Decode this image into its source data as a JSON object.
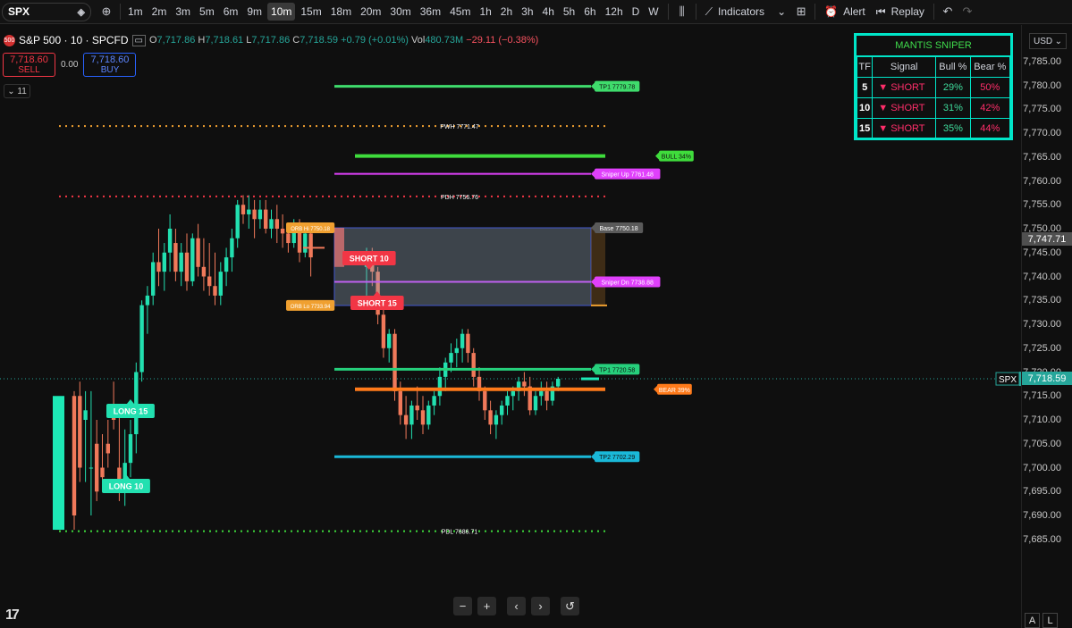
{
  "toolbar": {
    "symbol": "SPX",
    "intervals": [
      "1m",
      "2m",
      "3m",
      "5m",
      "6m",
      "9m",
      "10m",
      "15m",
      "18m",
      "20m",
      "30m",
      "36m",
      "45m",
      "1h",
      "2h",
      "3h",
      "4h",
      "5h",
      "6h",
      "12h",
      "D",
      "W"
    ],
    "active_interval": "10m",
    "indicators_label": "Indicators",
    "alert_label": "Alert",
    "replay_label": "Replay"
  },
  "legend": {
    "badge": "500",
    "name": "S&P 500 · 10 · SPCFD",
    "open_label": "O",
    "open": "7,717.86",
    "high_label": "H",
    "high": "7,718.61",
    "low_label": "L",
    "low": "7,717.86",
    "close_label": "C",
    "close": "7,718.59",
    "change": "+0.79 (+0.01%)",
    "vol_label": "Vol",
    "vol": "480.73M",
    "vol_change": "−29.11 (−0.38%)"
  },
  "trade": {
    "sell_price": "7,718.60",
    "sell_label": "SELL",
    "spread": "0.00",
    "buy_price": "7,718.60",
    "buy_label": "BUY",
    "collapse_count": "11"
  },
  "axis": {
    "currency": "USD",
    "ticks": [
      "7,785.00",
      "7,780.00",
      "7,775.00",
      "7,770.00",
      "7,765.00",
      "7,760.00",
      "7,755.00",
      "7,750.00",
      "7,745.00",
      "7,740.00",
      "7,735.00",
      "7,730.00",
      "7,725.00",
      "7,720.00",
      "7,715.00",
      "7,710.00",
      "7,705.00",
      "7,700.00",
      "7,695.00",
      "7,690.00",
      "7,685.00"
    ],
    "tag_gray": "7,747.71",
    "tag_symbol": "SPX",
    "tag_price": "7,718.59"
  },
  "levels": {
    "tp1_high": "TP1 7779.78",
    "pwh": "PWH 7771.47",
    "bull": "BULL 34%",
    "sniper_up": "Sniper Up 7761.48",
    "pdh": "PDH 7756.76",
    "orb_hi": "ORB Hi 7750.18",
    "base": "Base 7750.18",
    "short10": "SHORT 10",
    "short15": "SHORT 15",
    "sniper_dn": "Sniper Dn 7738.88",
    "orb_lo": "ORB Lo 7733.94",
    "tp1_low": "TP1 7720.58",
    "bear": "BEAR 39%",
    "long15": "LONG 15",
    "long10": "LONG 10",
    "tp2": "TP2 7702.29",
    "pdl": "PDL 7686.71"
  },
  "mantis": {
    "title": "MANTIS SNIPER",
    "headers": [
      "TF",
      "Signal",
      "Bull %",
      "Bear %"
    ],
    "rows": [
      {
        "tf": "5",
        "signal": "▼ SHORT",
        "bull": "29%",
        "bear": "50%"
      },
      {
        "tf": "10",
        "signal": "▼ SHORT",
        "bull": "31%",
        "bear": "42%"
      },
      {
        "tf": "15",
        "signal": "▼ SHORT",
        "bull": "35%",
        "bear": "44%"
      }
    ]
  },
  "colors": {
    "up": "#22e0b0",
    "down": "#f0795a",
    "bg": "#0f0f0f",
    "accent": "#00e5c8"
  },
  "chart_data": {
    "type": "candlestick",
    "symbol": "S&P 500 · 10 · SPCFD",
    "ylim": [
      7682,
      7788
    ],
    "candles": [
      [
        7715,
        7716,
        7687,
        7690
      ],
      [
        7715,
        7718,
        7697,
        7700
      ],
      [
        7710,
        7716,
        7697,
        7712
      ],
      [
        7700,
        7716,
        7690,
        7700
      ],
      [
        7705,
        7710,
        7693,
        7695
      ],
      [
        7700,
        7707,
        7697,
        7698
      ],
      [
        7705,
        7710,
        7700,
        7703
      ],
      [
        7712,
        7718,
        7708,
        7710
      ],
      [
        7700,
        7712,
        7693,
        7697
      ],
      [
        7697,
        7708,
        7692,
        7701
      ],
      [
        7701,
        7710,
        7698,
        7707
      ],
      [
        7707,
        7722,
        7703,
        7720
      ],
      [
        7720,
        7735,
        7718,
        7734
      ],
      [
        7734,
        7738,
        7728,
        7736
      ],
      [
        7736,
        7745,
        7734,
        7743
      ],
      [
        7743,
        7750,
        7738,
        7741
      ],
      [
        7741,
        7747,
        7737,
        7745
      ],
      [
        7745,
        7753,
        7741,
        7750
      ],
      [
        7747,
        7750,
        7739,
        7741
      ],
      [
        7741,
        7747,
        7738,
        7745
      ],
      [
        7745,
        7749,
        7737,
        7739
      ],
      [
        7739,
        7749,
        7738,
        7748
      ],
      [
        7748,
        7751,
        7740,
        7742
      ],
      [
        7742,
        7748,
        7737,
        7740
      ],
      [
        7740,
        7747,
        7736,
        7738
      ],
      [
        7738,
        7745,
        7734,
        7736
      ],
      [
        7736,
        7743,
        7734,
        7741
      ],
      [
        7741,
        7746,
        7738,
        7744
      ],
      [
        7744,
        7750,
        7741,
        7748
      ],
      [
        7748,
        7756,
        7746,
        7755
      ],
      [
        7755,
        7757,
        7751,
        7753
      ],
      [
        7753,
        7757,
        7750,
        7754
      ],
      [
        7754,
        7756,
        7748,
        7752
      ],
      [
        7752,
        7756,
        7750,
        7754
      ],
      [
        7754,
        7756,
        7749,
        7750
      ],
      [
        7750,
        7754,
        7748,
        7752
      ],
      [
        7752,
        7755,
        7747,
        7750
      ],
      [
        7750,
        7753,
        7746,
        7749
      ],
      [
        7749,
        7751,
        7745,
        7747
      ],
      [
        7747,
        7752,
        7746,
        7750
      ],
      [
        7750,
        7752,
        7743,
        7745
      ],
      [
        7745,
        7750,
        7744,
        7749
      ],
      [
        7749,
        7751,
        7740,
        7744
      ]
    ]
  }
}
